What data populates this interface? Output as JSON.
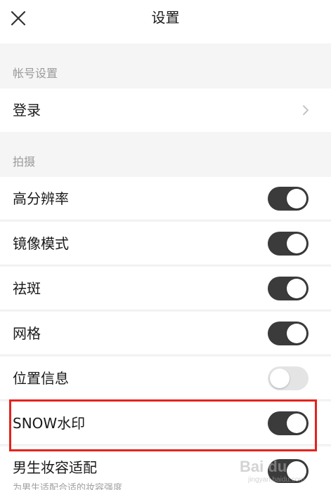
{
  "header": {
    "title": "设置",
    "close_icon": "close-icon"
  },
  "sections": {
    "account_label": "帐号设置",
    "shooting_label": "拍摄"
  },
  "rows": {
    "login": "登录",
    "high_res": "高分辨率",
    "mirror": "镜像模式",
    "freckle": "祛斑",
    "grid": "网格",
    "location": "位置信息",
    "snow_watermark": "SNOW水印",
    "male_makeup": "男生妆容适配",
    "male_makeup_desc": "为男生适配合适的妆容强度"
  },
  "toggles": {
    "high_res": true,
    "mirror": true,
    "freckle": true,
    "grid": true,
    "location": false,
    "snow_watermark": true,
    "male_makeup": true
  },
  "watermark": {
    "text": "Bai du",
    "sub": "jingyan.baidu.com"
  },
  "colors": {
    "toggle_on": "#3b3b3b",
    "toggle_off": "#e4e4e4",
    "highlight": "#e5221c"
  }
}
